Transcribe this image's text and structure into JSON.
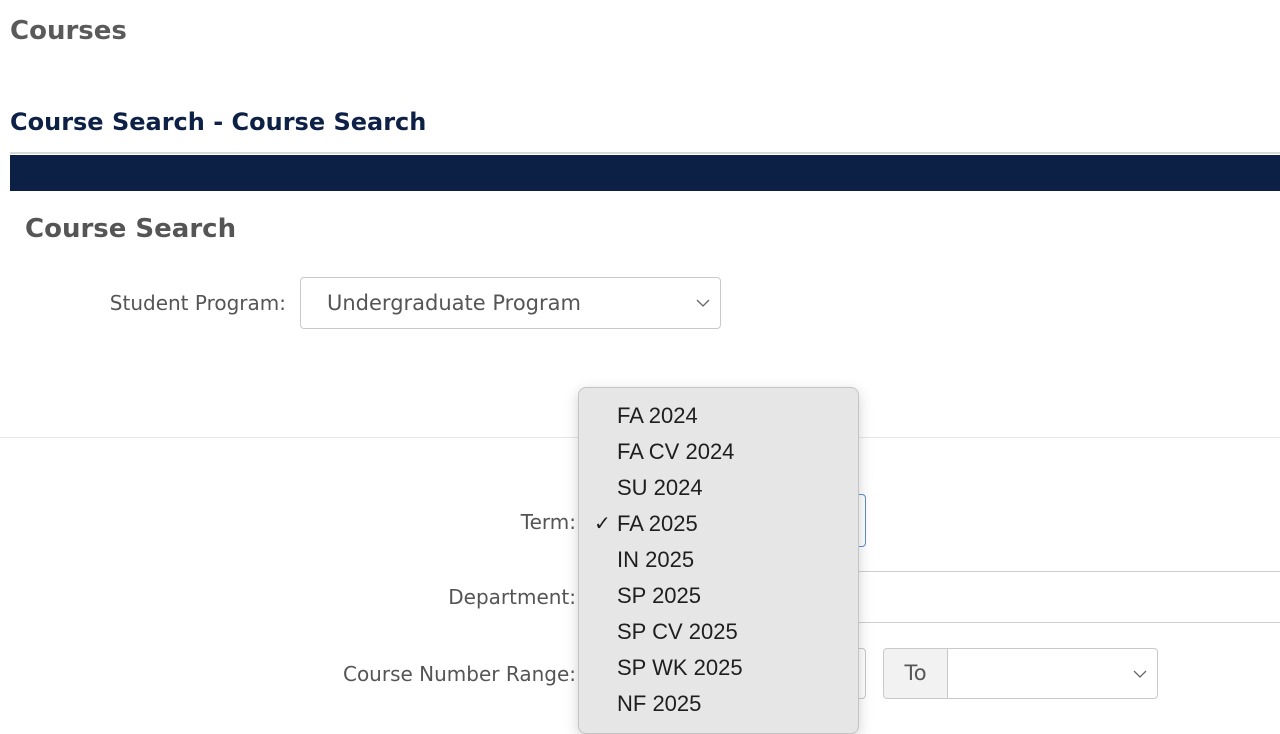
{
  "page": {
    "title": "Courses"
  },
  "section": {
    "title": "Course Search - Course Search"
  },
  "panel": {
    "title": "Course Search"
  },
  "form": {
    "student_program": {
      "label": "Student Program:",
      "value": "Undergraduate Program"
    },
    "term": {
      "label": "Term:"
    },
    "department": {
      "label": "Department:"
    },
    "course_number_range": {
      "label": "Course Number Range:",
      "to_label": "To"
    }
  },
  "term_dropdown": {
    "selected": "FA 2025",
    "options": [
      "FA 2024",
      "FA CV 2024",
      "SU 2024",
      "FA 2025",
      "IN 2025",
      "SP 2025",
      "SP CV 2025",
      "SP WK 2025",
      "NF 2025"
    ]
  },
  "icons": {
    "select_arrow": "chevron-down-icon",
    "selected_mark": "checkmark-icon"
  },
  "colors": {
    "navy": "#0c2046",
    "heading_navy": "#0d2046",
    "focus_border": "#5b8fd6"
  }
}
